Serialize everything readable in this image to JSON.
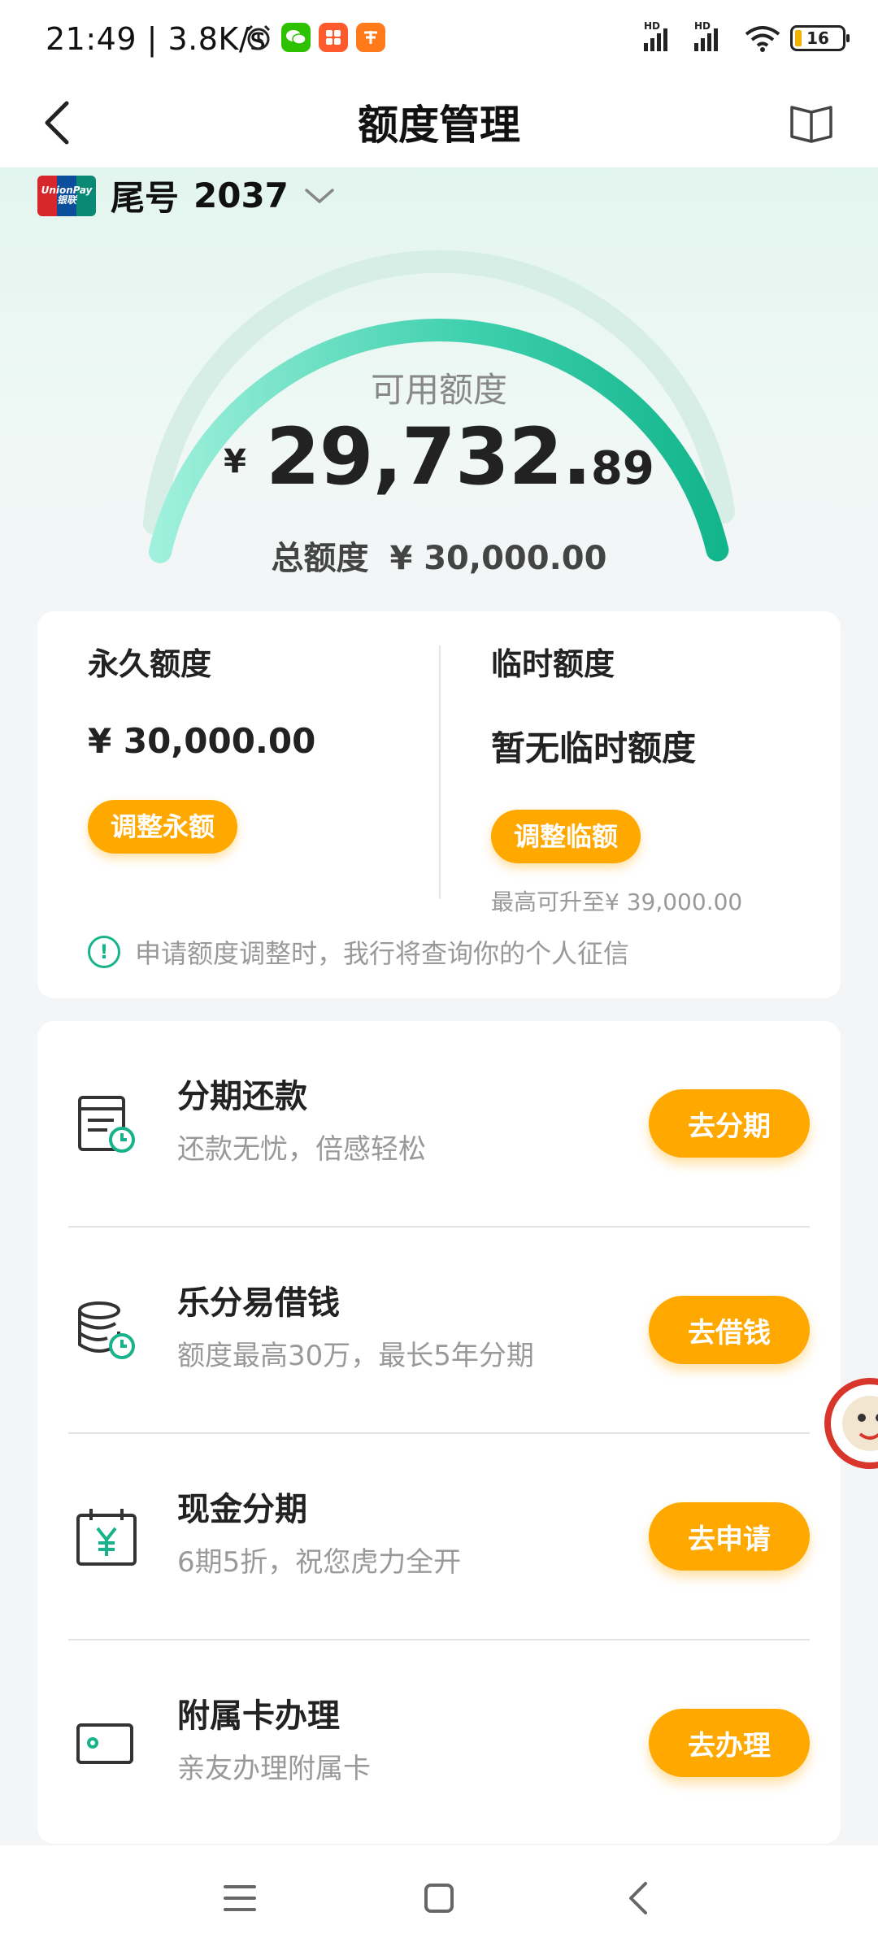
{
  "status_bar": {
    "time": "21:49 | 3.8K/s",
    "battery": "16"
  },
  "header": {
    "title": "额度管理"
  },
  "card_selector": {
    "label": "尾号",
    "number": "2037",
    "brand_text": "UnionPay 银联"
  },
  "credit": {
    "available_label": "可用额度",
    "currency": "¥",
    "available_integer": "29,732.",
    "available_decimal": "89",
    "total_label": "总额度",
    "total_value": "¥ 30,000.00",
    "gauge_fraction": 0.991
  },
  "limits": {
    "permanent": {
      "title": "永久额度",
      "value": "¥ 30,000.00",
      "button": "调整永额"
    },
    "temporary": {
      "title": "临时额度",
      "value": "暂无临时额度",
      "button": "调整临额",
      "note": "最高可升至¥ 39,000.00"
    },
    "notice": "申请额度调整时，我行将查询你的个人征信"
  },
  "services": [
    {
      "title": "分期还款",
      "subtitle": "还款无忧，倍感轻松",
      "button": "去分期",
      "icon": "bill-clock-icon"
    },
    {
      "title": "乐分易借钱",
      "subtitle": "额度最高30万，最长5年分期",
      "button": "去借钱",
      "icon": "coins-clock-icon"
    },
    {
      "title": "现金分期",
      "subtitle": "6期5折，祝您虎力全开",
      "button": "去申请",
      "icon": "calendar-yen-icon"
    },
    {
      "title": "附属卡办理",
      "subtitle": "亲友办理附属卡",
      "button": "去办理",
      "icon": "card-icon"
    }
  ],
  "colors": {
    "accent_green": "#19b38b",
    "button_orange": "#ffa800"
  }
}
